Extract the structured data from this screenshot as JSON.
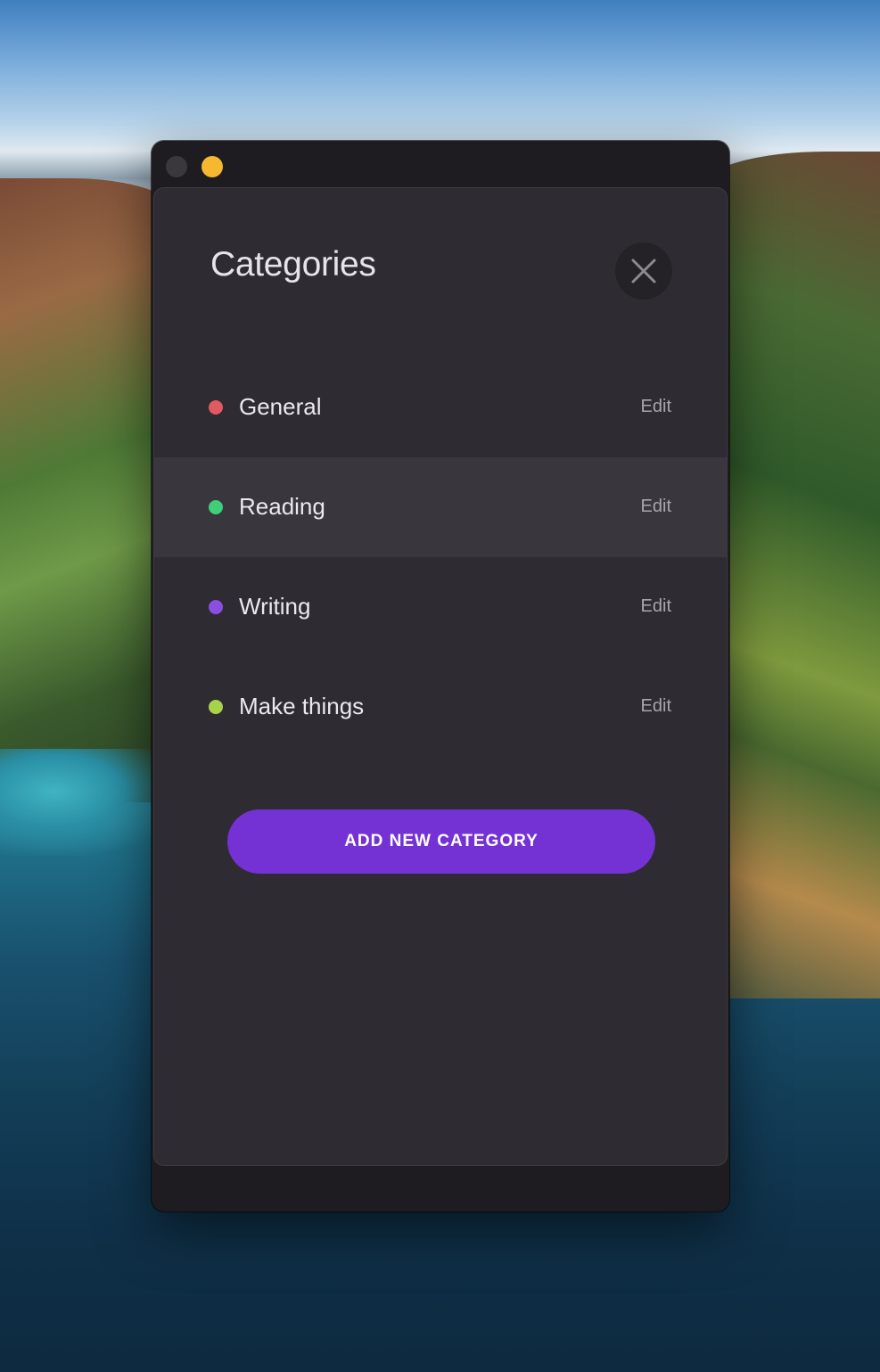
{
  "window": {
    "traffic_lights": [
      {
        "name": "close",
        "color": "#3a383d"
      },
      {
        "name": "minimize",
        "color": "#f5b82e"
      }
    ]
  },
  "sheet": {
    "title": "Categories",
    "close_icon": "close-icon"
  },
  "categories": [
    {
      "label": "General",
      "color": "#e05a5f",
      "edit_label": "Edit"
    },
    {
      "label": "Reading",
      "color": "#3fcf78",
      "edit_label": "Edit"
    },
    {
      "label": "Writing",
      "color": "#8b4fe0",
      "edit_label": "Edit"
    },
    {
      "label": "Make things",
      "color": "#a8d24a",
      "edit_label": "Edit"
    }
  ],
  "add_button": {
    "label": "ADD NEW CATEGORY",
    "color": "#7432d4"
  }
}
